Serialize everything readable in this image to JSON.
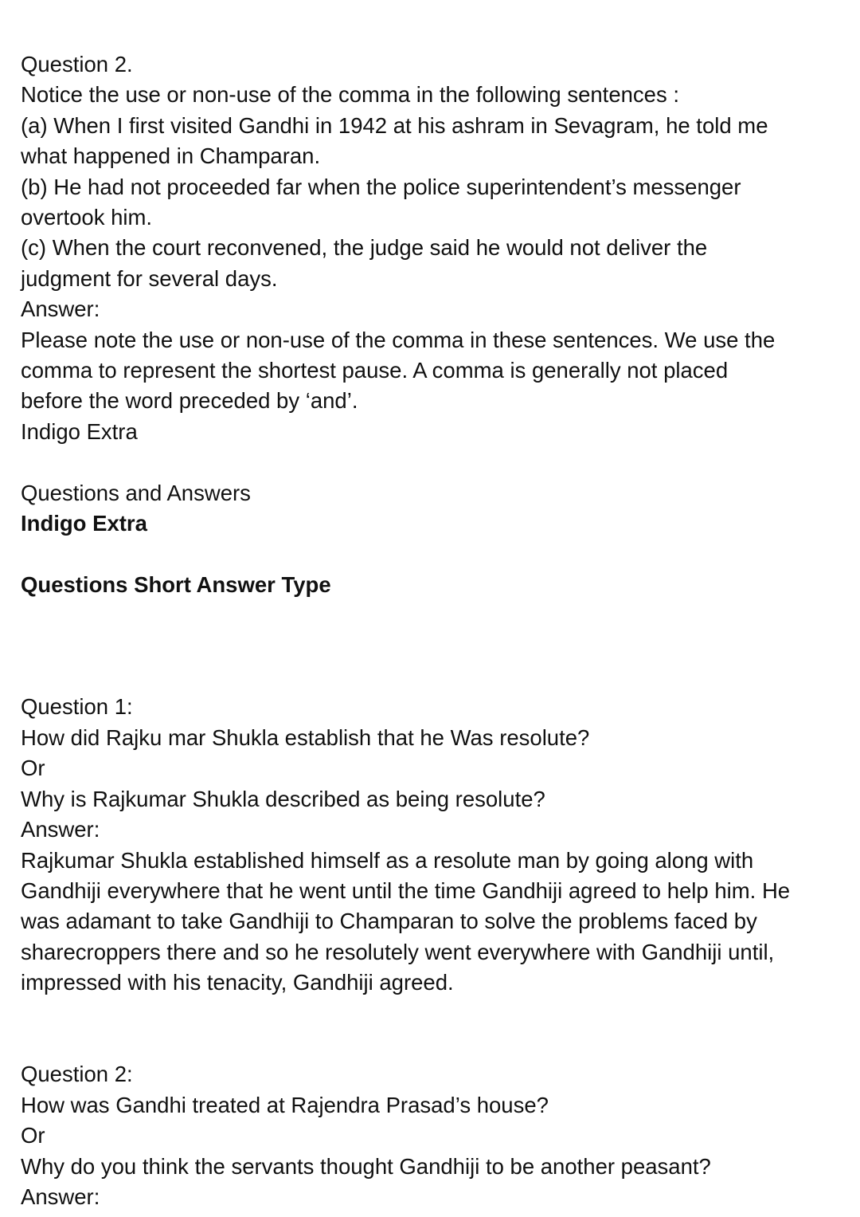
{
  "q2_grammar": {
    "heading": "Question 2.",
    "prompt": "Notice the use or non-use of the comma in the following sentences :",
    "items": [
      [
        "(a) When I first visited Gandhi in 1942 at his ashram in Sevagram, he told me",
        "what happened in Champaran."
      ],
      [
        "(b) He had not proceeded far when the police superintendent’s messenger",
        "overtook him."
      ],
      [
        "(c) When the court reconvened, the judge said he would not deliver the",
        "judgment for several days."
      ]
    ],
    "answer_label": "Answer:",
    "answer_lines": [
      "Please note the use or non-use of the comma in these sentences. We use the",
      "comma to represent the shortest pause. A comma is generally not placed",
      "before the word preceded by ‘and’."
    ],
    "trailing": "Indigo Extra"
  },
  "section": {
    "label": "Questions and Answers",
    "title": "Indigo Extra",
    "subtitle": "Questions Short Answer Type"
  },
  "short_q1": {
    "heading": "Question 1:",
    "question": "How did Rajku mar Shukla establish that he Was resolute?",
    "or": "Or",
    "alt_question": "Why is Rajkumar Shukla described as being resolute?",
    "answer_label": "Answer:",
    "answer_lines": [
      "Rajkumar Shukla established himself as a resolute man by going along with",
      "Gandhiji everywhere that he went until the time Gandhiji agreed to help him. He",
      "was adamant to take Gandhiji to Champaran to solve the problems faced by",
      "sharecroppers there and so he resolutely went everywhere with Gandhiji until,",
      "impressed with his tenacity, Gandhiji agreed."
    ]
  },
  "short_q2": {
    "heading": "Question 2:",
    "question": "How was Gandhi treated at Rajendra Prasad’s house?",
    "or": "Or",
    "alt_question": "Why do you think the servants thought Gandhiji to be another peasant?",
    "answer_label": "Answer:"
  }
}
